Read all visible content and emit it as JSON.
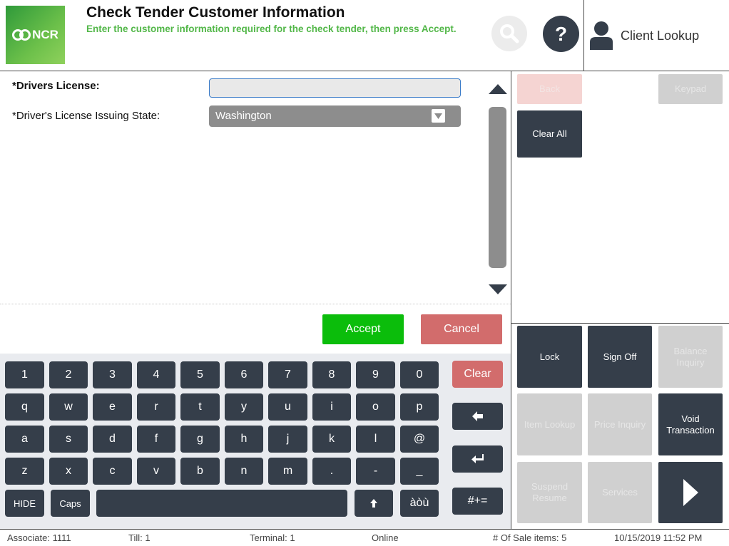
{
  "header": {
    "logo_text": "NCR",
    "title": "Check Tender Customer Information",
    "subtitle": "Enter the customer information required for the check tender, then press Accept.",
    "help_label": "?",
    "client_lookup_label": "Client Lookup"
  },
  "form": {
    "drivers_license_label": "*Drivers License:",
    "drivers_license_value": "",
    "issuing_state_label": "*Driver's License Issuing State:",
    "issuing_state_value": "Washington"
  },
  "actions": {
    "accept_label": "Accept",
    "cancel_label": "Cancel"
  },
  "keyboard": {
    "row1": [
      "1",
      "2",
      "3",
      "4",
      "5",
      "6",
      "7",
      "8",
      "9",
      "0"
    ],
    "row2": [
      "q",
      "w",
      "e",
      "r",
      "t",
      "y",
      "u",
      "i",
      "o",
      "p"
    ],
    "row3": [
      "a",
      "s",
      "d",
      "f",
      "g",
      "h",
      "j",
      "k",
      "l",
      "@"
    ],
    "row4": [
      "z",
      "x",
      "c",
      "v",
      "b",
      "n",
      "m",
      ".",
      "-",
      "_"
    ],
    "hide_label": "HIDE",
    "caps_label": "Caps",
    "accent_label": "àòù",
    "clear_label": "Clear",
    "symbols_label": "#+="
  },
  "panel": {
    "back_label": "Back",
    "keypad_label": "Keypad",
    "clear_all_label": "Clear All",
    "lock_label": "Lock",
    "sign_off_label": "Sign Off",
    "balance_inquiry_label": "Balance Inquiry",
    "item_lookup_label": "Item Lookup",
    "price_inquiry_label": "Price Inquiry",
    "void_transaction_label": "Void Transaction",
    "suspend_resume_label": "Suspend Resume",
    "services_label": "Services"
  },
  "status": {
    "associate": "Associate: 1111",
    "till": "Till: 1",
    "terminal": "Terminal: 1",
    "connection": "Online",
    "sale_items": "# Of Sale items: 5",
    "datetime": "10/15/2019 11:52 PM"
  },
  "colors": {
    "dark_button": "#353e4a",
    "accept_green": "#0bbd0b",
    "cancel_red": "#d26c6c",
    "subtitle_green": "#52b748",
    "disabled_gray": "#d0d0d0"
  }
}
